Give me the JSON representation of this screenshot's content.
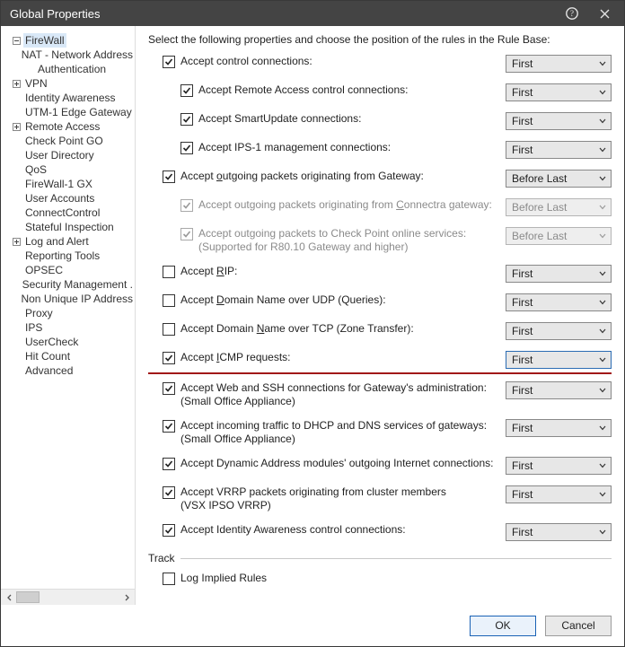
{
  "window": {
    "title": "Global Properties"
  },
  "sidebar": {
    "items": [
      {
        "label": "FireWall",
        "depth": 0,
        "expander": "minus",
        "selected": true
      },
      {
        "label": "NAT - Network Address",
        "depth": 1,
        "expander": "dot"
      },
      {
        "label": "Authentication",
        "depth": 1,
        "expander": "none"
      },
      {
        "label": "VPN",
        "depth": 0,
        "expander": "plus"
      },
      {
        "label": "Identity Awareness",
        "depth": 0,
        "expander": "none"
      },
      {
        "label": "UTM-1 Edge Gateway",
        "depth": 0,
        "expander": "none"
      },
      {
        "label": "Remote Access",
        "depth": 0,
        "expander": "plus"
      },
      {
        "label": "Check Point GO",
        "depth": 0,
        "expander": "none"
      },
      {
        "label": "User Directory",
        "depth": 0,
        "expander": "none"
      },
      {
        "label": "QoS",
        "depth": 0,
        "expander": "none"
      },
      {
        "label": "FireWall-1 GX",
        "depth": 0,
        "expander": "none"
      },
      {
        "label": "User Accounts",
        "depth": 0,
        "expander": "none"
      },
      {
        "label": "ConnectControl",
        "depth": 0,
        "expander": "none"
      },
      {
        "label": "Stateful Inspection",
        "depth": 0,
        "expander": "none"
      },
      {
        "label": "Log and Alert",
        "depth": 0,
        "expander": "plus"
      },
      {
        "label": "Reporting Tools",
        "depth": 0,
        "expander": "none"
      },
      {
        "label": "OPSEC",
        "depth": 0,
        "expander": "none"
      },
      {
        "label": "Security Management .",
        "depth": 0,
        "expander": "none"
      },
      {
        "label": "Non Unique IP Address",
        "depth": 0,
        "expander": "none"
      },
      {
        "label": "Proxy",
        "depth": 0,
        "expander": "none"
      },
      {
        "label": "IPS",
        "depth": 0,
        "expander": "none"
      },
      {
        "label": "UserCheck",
        "depth": 0,
        "expander": "none"
      },
      {
        "label": "Hit Count",
        "depth": 0,
        "expander": "none"
      },
      {
        "label": "Advanced",
        "depth": 0,
        "expander": "none"
      }
    ]
  },
  "main": {
    "intro": "Select the following properties and choose the position of the rules in the Rule Base:",
    "rows": [
      {
        "indent": 0,
        "checked": true,
        "disabled": false,
        "label": "Accept control connections:",
        "combo": "First"
      },
      {
        "indent": 1,
        "checked": true,
        "disabled": false,
        "label": "Accept Remote Access control connections:",
        "combo": "First"
      },
      {
        "indent": 1,
        "checked": true,
        "disabled": false,
        "label": "Accept SmartUpdate connections:",
        "combo": "First"
      },
      {
        "indent": 1,
        "checked": true,
        "disabled": false,
        "label": "Accept IPS-1 management connections:",
        "combo": "First"
      },
      {
        "indent": 0,
        "checked": true,
        "disabled": false,
        "label": "Accept outgoing packets originating from Gateway:",
        "u": "o",
        "combo": "Before Last"
      },
      {
        "indent": 1,
        "checked": true,
        "disabled": true,
        "label": "Accept outgoing packets originating from Connectra gateway:",
        "u": "C",
        "combo": "Before Last"
      },
      {
        "indent": 1,
        "checked": true,
        "disabled": true,
        "label": "Accept outgoing packets to Check Point online services:",
        "sub": "(Supported for R80.10 Gateway and higher)",
        "combo": "Before Last"
      },
      {
        "indent": 0,
        "checked": false,
        "disabled": false,
        "label": "Accept RIP:",
        "u": "R",
        "combo": "First"
      },
      {
        "indent": 0,
        "checked": false,
        "disabled": false,
        "label": "Accept Domain Name over UDP (Queries):",
        "u": "D",
        "combo": "First"
      },
      {
        "indent": 0,
        "checked": false,
        "disabled": false,
        "label": "Accept Domain Name over TCP (Zone Transfer):",
        "u": "N",
        "combo": "First"
      },
      {
        "indent": 0,
        "checked": true,
        "disabled": false,
        "label": "Accept ICMP requests:",
        "u": "I",
        "combo": "First",
        "highlight": true,
        "comboFocus": true
      },
      {
        "indent": 0,
        "checked": true,
        "disabled": false,
        "label": "Accept Web and SSH connections for Gateway's administration:",
        "sub": "(Small Office Appliance)",
        "combo": "First"
      },
      {
        "indent": 0,
        "checked": true,
        "disabled": false,
        "label": "Accept incoming traffic to DHCP and DNS services of gateways:",
        "sub": "(Small Office Appliance)",
        "combo": "First"
      },
      {
        "indent": 0,
        "checked": true,
        "disabled": false,
        "label": "Accept Dynamic Address modules' outgoing Internet connections:",
        "combo": "First"
      },
      {
        "indent": 0,
        "checked": true,
        "disabled": false,
        "label": "Accept VRRP packets originating from cluster members",
        "sub": "(VSX IPSO VRRP)",
        "combo": "First"
      },
      {
        "indent": 0,
        "checked": true,
        "disabled": false,
        "label": "Accept Identity Awareness control connections:",
        "combo": "First"
      }
    ],
    "trackHeader": "Track",
    "logImplied": {
      "checked": false,
      "label": "Log Implied Rules"
    }
  },
  "footer": {
    "ok": "OK",
    "cancel": "Cancel"
  }
}
